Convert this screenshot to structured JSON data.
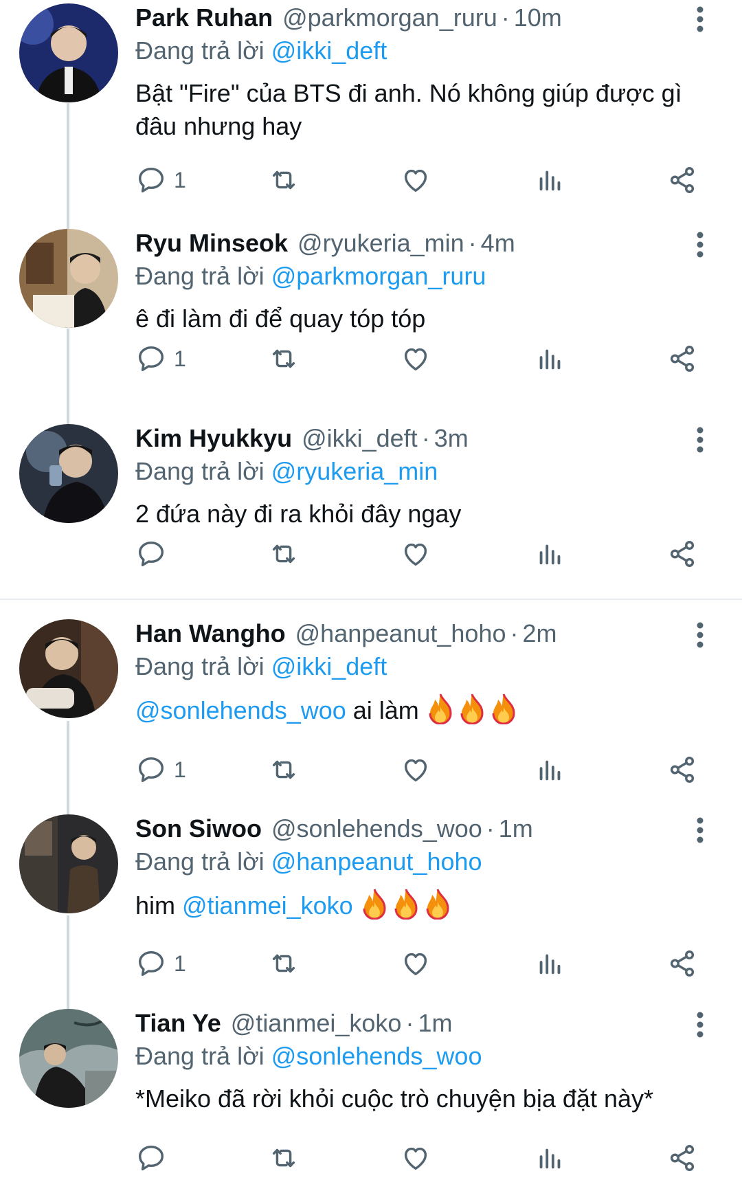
{
  "reply_prefix": "Đang trả lời",
  "colors": {
    "mention": "#1d9bf0",
    "secondary": "#536471",
    "text": "#0f1419",
    "thread_line": "#cfd9de"
  },
  "tweets": [
    {
      "name": "Park Ruhan",
      "handle": "@parkmorgan_ruru",
      "time": "10m",
      "reply_to": "@ikki_deft",
      "text": "Bật \"Fire\" của BTS đi anh. Nó không giúp được gì đâu nhưng hay",
      "reply_count": "1",
      "avatar_icon": "avatar-photo"
    },
    {
      "name": "Ryu Minseok",
      "handle": "@ryukeria_min",
      "time": "4m",
      "reply_to": "@parkmorgan_ruru",
      "text": "ê đi làm đi để quay tóp tóp",
      "reply_count": "1",
      "avatar_icon": "avatar-photo"
    },
    {
      "name": "Kim Hyukkyu",
      "handle": "@ikki_deft",
      "time": "3m",
      "reply_to": "@ryukeria_min",
      "text": "2 đứa này đi ra khỏi đây ngay",
      "reply_count": "",
      "avatar_icon": "avatar-photo"
    },
    {
      "name": "Han Wangho",
      "handle": "@hanpeanut_hoho",
      "time": "2m",
      "reply_to": "@ikki_deft",
      "text_mention": "@sonlehends_woo",
      "text": " ai làm ",
      "reply_count": "1",
      "avatar_icon": "avatar-photo",
      "emoji": "fire-emoji x3"
    },
    {
      "name": "Son Siwoo",
      "handle": "@sonlehends_woo",
      "time": "1m",
      "reply_to": "@hanpeanut_hoho",
      "text": "him ",
      "text_mention": "@tianmei_koko",
      "reply_count": "1",
      "avatar_icon": "avatar-photo",
      "emoji": "fire-emoji x3"
    },
    {
      "name": "Tian Ye",
      "handle": "@tianmei_koko",
      "time": "1m",
      "reply_to": "@sonlehends_woo",
      "text": "*Meiko đã rời khỏi cuộc trò chuyện bịa đặt này*",
      "reply_count": "",
      "avatar_icon": "avatar-photo"
    }
  ]
}
